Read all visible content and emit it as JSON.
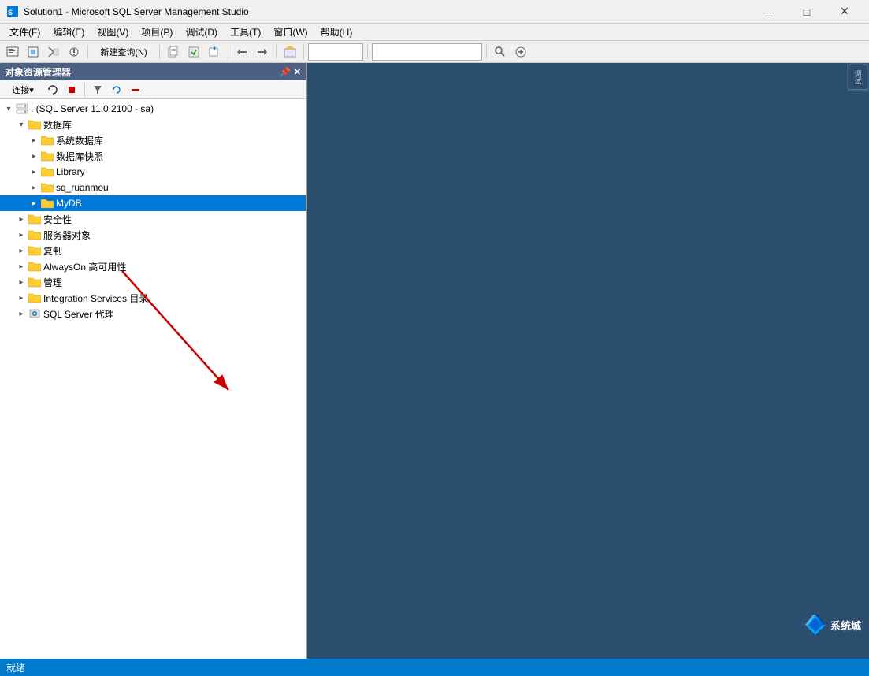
{
  "window": {
    "title": "Solution1 - Microsoft SQL Server Management Studio",
    "icon": "ssms-icon"
  },
  "titlebar": {
    "minimize_label": "—",
    "maximize_label": "□",
    "close_label": "✕"
  },
  "menubar": {
    "items": [
      {
        "label": "文件(F)"
      },
      {
        "label": "编辑(E)"
      },
      {
        "label": "视图(V)"
      },
      {
        "label": "项目(P)"
      },
      {
        "label": "调试(D)"
      },
      {
        "label": "工具(T)"
      },
      {
        "label": "窗口(W)"
      },
      {
        "label": "帮助(H)"
      }
    ]
  },
  "object_explorer": {
    "panel_title": "对象资源管理器",
    "connect_label": "连接▾",
    "tree": {
      "server": ". (SQL Server 11.0.2100 - sa)",
      "nodes": [
        {
          "id": "databases",
          "label": "数据库",
          "indent": 1,
          "type": "folder",
          "expanded": true
        },
        {
          "id": "sys_db",
          "label": "系统数据库",
          "indent": 2,
          "type": "folder"
        },
        {
          "id": "db_snapshot",
          "label": "数据库快照",
          "indent": 2,
          "type": "folder"
        },
        {
          "id": "library",
          "label": "Library",
          "indent": 2,
          "type": "folder"
        },
        {
          "id": "sq_ruanmou",
          "label": "sq_ruanmou",
          "indent": 2,
          "type": "folder"
        },
        {
          "id": "mydb",
          "label": "MyDB",
          "indent": 2,
          "type": "folder",
          "selected": true
        },
        {
          "id": "security",
          "label": "安全性",
          "indent": 1,
          "type": "folder"
        },
        {
          "id": "server_obj",
          "label": "服务器对象",
          "indent": 1,
          "type": "folder"
        },
        {
          "id": "replication",
          "label": "复制",
          "indent": 1,
          "type": "folder"
        },
        {
          "id": "always_on",
          "label": "AlwaysOn 高可用性",
          "indent": 1,
          "type": "folder"
        },
        {
          "id": "management",
          "label": "管理",
          "indent": 1,
          "type": "folder"
        },
        {
          "id": "integration",
          "label": "Integration Services 目录",
          "indent": 1,
          "type": "folder"
        },
        {
          "id": "sql_agent",
          "label": "SQL Server 代理",
          "indent": 1,
          "type": "agent"
        }
      ]
    }
  },
  "status_bar": {
    "text": "就绪"
  },
  "watermark": {
    "text": "系统城"
  },
  "colors": {
    "selected_bg": "#0078d7",
    "content_bg": "#2b4d6e",
    "panel_bg": "#ffffff"
  }
}
